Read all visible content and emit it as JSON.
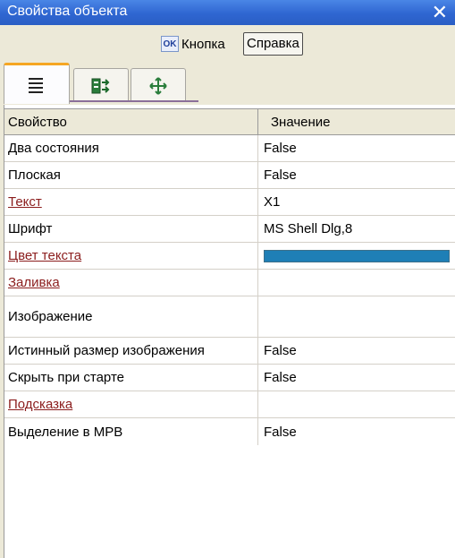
{
  "window": {
    "title": "Свойства объекта"
  },
  "toolbar": {
    "ok_icon_text": "OK",
    "button_label": "Кнопка",
    "help_label": "Справка"
  },
  "tabs": [
    {
      "icon": "list-icon"
    },
    {
      "icon": "events-icon"
    },
    {
      "icon": "move-icon"
    }
  ],
  "grid": {
    "headers": {
      "property": "Свойство",
      "value": "Значение"
    },
    "rows": [
      {
        "property": "Два состояния",
        "value": "False",
        "link": false
      },
      {
        "property": "Плоская",
        "value": "False",
        "link": false
      },
      {
        "property": "Текст",
        "value": "X1",
        "link": true
      },
      {
        "property": "Шрифт",
        "value": "MS Shell Dlg,8",
        "link": false
      },
      {
        "property": "Цвет текста",
        "value": "",
        "link": true,
        "color": "#1f7fb6"
      },
      {
        "property": "Заливка",
        "value": "",
        "link": true
      },
      {
        "property": "Изображение",
        "value": "",
        "link": false
      },
      {
        "property": "Истинный размер изображения",
        "value": "False",
        "link": false
      },
      {
        "property": "Скрыть при старте",
        "value": "False",
        "link": false
      },
      {
        "property": "Подсказка",
        "value": "",
        "link": true
      },
      {
        "property": "Выделение в МРВ",
        "value": "False",
        "link": false
      }
    ]
  }
}
